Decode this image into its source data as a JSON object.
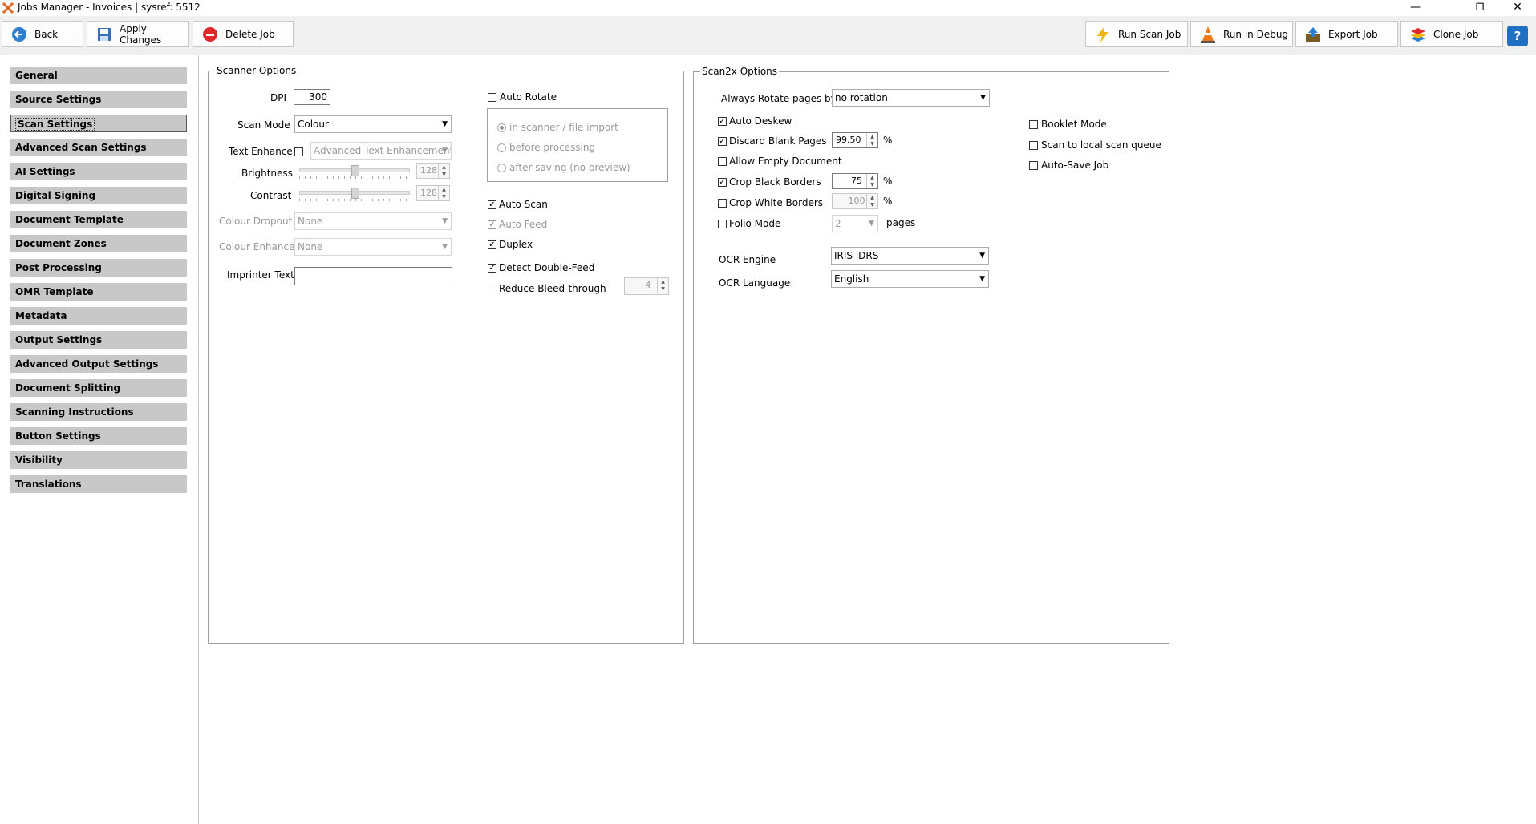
{
  "window": {
    "title": "Jobs Manager - Invoices  |  sysref: 5512"
  },
  "toolbar": {
    "back": "Back",
    "apply": "Apply Changes",
    "delete": "Delete Job",
    "run_scan": "Run Scan Job",
    "run_debug": "Run in Debug",
    "export": "Export Job",
    "clone": "Clone Job",
    "help": "?"
  },
  "sidebar": {
    "items": [
      "General",
      "Source Settings",
      "Scan Settings",
      "Advanced Scan Settings",
      "AI Settings",
      "Digital Signing",
      "Document Template",
      "Document Zones",
      "Post Processing",
      "OMR Template",
      "Metadata",
      "Output Settings",
      "Advanced Output Settings",
      "Document Splitting",
      "Scanning Instructions",
      "Button Settings",
      "Visibility",
      "Translations"
    ],
    "selected": "Scan Settings"
  },
  "scanner_options": {
    "title": "Scanner Options",
    "dpi_label": "DPI",
    "dpi": "300",
    "scan_mode_label": "Scan Mode",
    "scan_mode": "Colour",
    "text_enhance_label": "Text Enhance",
    "text_enhance_value": "Advanced Text Enhancement",
    "brightness_label": "Brightness",
    "brightness": "128",
    "contrast_label": "Contrast",
    "contrast": "128",
    "colour_dropout_label": "Colour Dropout",
    "colour_dropout": "None",
    "colour_enhance_label": "Colour Enhance",
    "colour_enhance": "None",
    "imprinter_label": "Imprinter Text",
    "imprinter": "",
    "auto_rotate": "Auto Rotate",
    "rotate_opt1": "in scanner / file import",
    "rotate_opt2": "before processing",
    "rotate_opt3": "after saving (no preview)",
    "auto_scan": "Auto Scan",
    "auto_feed": "Auto Feed",
    "duplex": "Duplex",
    "detect_double_feed": "Detect Double-Feed",
    "reduce_bleed": "Reduce Bleed-through",
    "bleed_value": "4"
  },
  "scan2x_options": {
    "title": "Scan2x Options",
    "always_rotate_label": "Always Rotate pages by",
    "always_rotate": "no rotation",
    "auto_deskew": "Auto Deskew",
    "discard_blank": "Discard Blank Pages",
    "discard_blank_value": "99.50",
    "allow_empty": "Allow Empty Document",
    "crop_black": "Crop Black Borders",
    "crop_black_value": "75",
    "crop_white": "Crop White Borders",
    "crop_white_value": "100",
    "folio_mode": "Folio Mode",
    "folio_value": "2",
    "pages": "pages",
    "percent": "%",
    "ocr_engine_label": "OCR Engine",
    "ocr_engine": "IRIS iDRS",
    "ocr_language_label": "OCR Language",
    "ocr_language": "English",
    "booklet_mode": "Booklet Mode",
    "scan_local_queue": "Scan to local scan queue",
    "auto_save": "Auto-Save Job"
  },
  "colors": {
    "sidebar_item_bg": "#c8c8c8",
    "toolbar_bg": "#f0f0f0"
  }
}
